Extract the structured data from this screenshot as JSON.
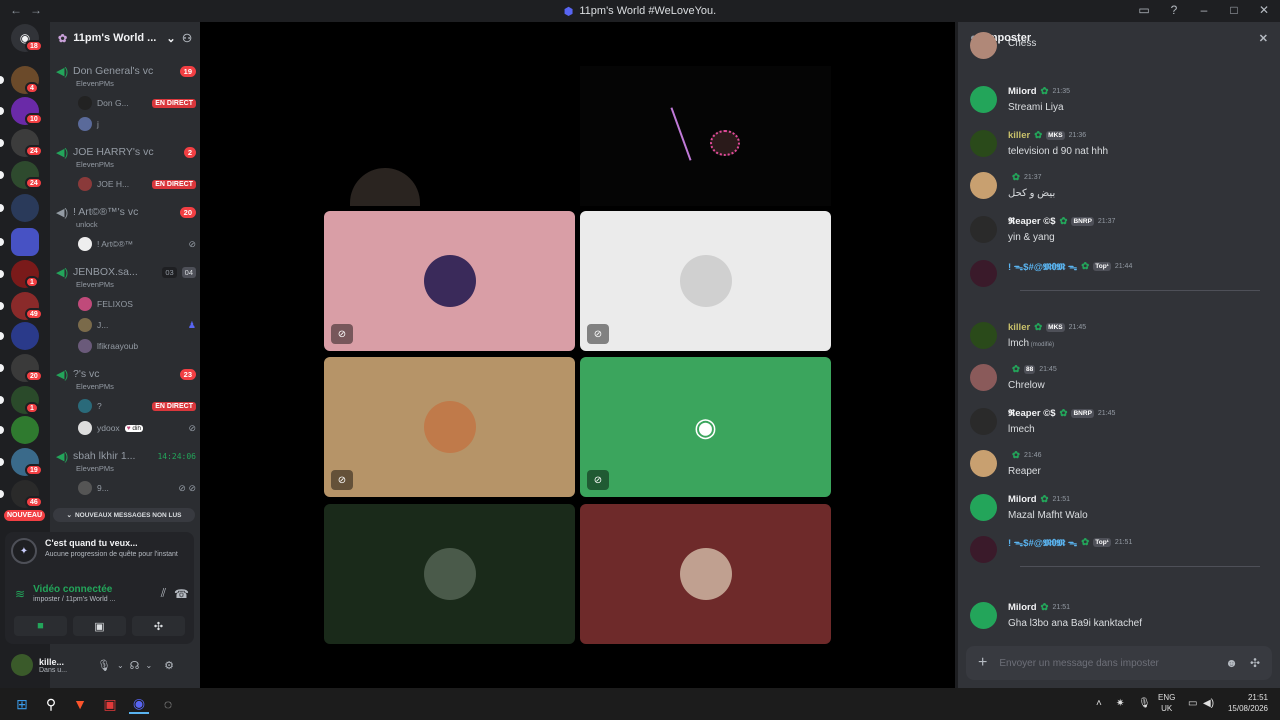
{
  "window": {
    "title": "11pm's World #WeLoveYou."
  },
  "rail": {
    "home_badge": "18",
    "servers": [
      {
        "badge": "4",
        "color": "#6b4a2a"
      },
      {
        "badge": "10",
        "color": "#6a2aa8"
      },
      {
        "badge": "24",
        "color": "#3c3c3c"
      },
      {
        "badge": "24",
        "color": "#2e4a2e"
      },
      {
        "badge": "",
        "color": "#2a3a5a"
      },
      {
        "badge": "",
        "color": "#4752c4"
      },
      {
        "badge": "1",
        "color": "#7a1a1a"
      },
      {
        "badge": "49",
        "color": "#8a2a2a"
      },
      {
        "badge": "",
        "color": "#2a3a8a"
      },
      {
        "badge": "20",
        "color": "#3a3a3a"
      },
      {
        "badge": "1",
        "color": "#2a4a2a"
      },
      {
        "badge": "",
        "color": "#2f7a2f"
      },
      {
        "badge": "19",
        "color": "#3a6a8a"
      },
      {
        "badge": "46",
        "color": "#2a2a2a"
      }
    ],
    "new_label": "NOUVEAU"
  },
  "guild": {
    "name": "11pm's World ..."
  },
  "channels": [
    {
      "name": "Don General's vc",
      "sub": "ElevenPMs",
      "count": "19"
    },
    {
      "name": "JOE HARRY's vc",
      "sub": "ElevenPMs",
      "count": "2"
    },
    {
      "name": "! Art©®™'s vc",
      "sub": "unlock",
      "count": "20"
    },
    {
      "name": "JENBOX.sa...",
      "sub": "ElevenPMs",
      "count_a": "03",
      "count_b": "04"
    },
    {
      "name": "?'s vc",
      "sub": "ElevenPMs",
      "count": "23"
    },
    {
      "name": "sbah lkhir 1...",
      "sub": "ElevenPMs",
      "timer": "14:24:06"
    }
  ],
  "members": {
    "u1": "Don G...",
    "u2": "j",
    "u3": "JOE H...",
    "u4": "! Art©®™",
    "u5": "FELIXOS",
    "u6": "J...",
    "u7": "lfikraayoub",
    "u8": "?",
    "u9": "ydoox",
    "u9_tag": "dih",
    "u10": "9...",
    "live": "EN DIRECT"
  },
  "new_messages": "NOUVEAUX MESSAGES NON LUS",
  "quest": {
    "title": "C'est quand tu veux...",
    "subtitle": "Aucune progression de quête pour l'instant"
  },
  "voice": {
    "status": "Vidéo connectée",
    "location": "imposter / 11pm's World ..."
  },
  "user": {
    "name": "kille...",
    "status": "Dans u..."
  },
  "chat": {
    "channel": "imposter",
    "input_placeholder": "Envoyer un message dans imposter",
    "messages": [
      {
        "author": "",
        "time": "",
        "text": "Chess",
        "avatar_color": "#b08878"
      },
      {
        "author": "Milord",
        "time": "21:35",
        "text": "Streami Liya",
        "avatar_color": "#23a55a"
      },
      {
        "author": "killer",
        "tag": "MKS",
        "time": "21:36",
        "text": "television d 90 nat hhh",
        "avatar_color": "#2a4a1a"
      },
      {
        "author": "",
        "time": "21:37",
        "text": "بيض و كحل",
        "avatar_color": "#c8a070"
      },
      {
        "author": "𝕽eaper ©$",
        "tag": "BNRP",
        "time": "21:37",
        "text": "yin & yang",
        "avatar_color": "#2a2a2a"
      },
      {
        "author": "! ᯓ$#@𝕸𝟎𝕸 ᯓ",
        "tag": "Top¹",
        "time": "21:44",
        "text": "",
        "avatar_color": "#3a1a2a"
      },
      {
        "author": "killer",
        "tag": "MKS",
        "time": "21:45",
        "text": "lmch",
        "edited": "(modifié)",
        "avatar_color": "#2a4a1a"
      },
      {
        "author": "",
        "tag": "88",
        "time": "21:45",
        "text": "Chrelow",
        "avatar_color": "#8a5a5a"
      },
      {
        "author": "𝕽eaper ©$",
        "tag": "BNRP",
        "time": "21:45",
        "text": "lmech",
        "avatar_color": "#2a2a2a"
      },
      {
        "author": "",
        "time": "21:46",
        "text": "Reaper",
        "avatar_color": "#c8a070"
      },
      {
        "author": "Milord",
        "time": "21:51",
        "text": "Mazal Mafht Walo",
        "avatar_color": "#23a55a"
      },
      {
        "author": "! ᯓ$#@𝕸𝟎𝕸 ᯓ",
        "tag": "Top¹",
        "time": "21:51",
        "text": "",
        "avatar_color": "#3a1a2a"
      },
      {
        "author": "Milord",
        "time": "21:51",
        "text": "Gha l3bo ana Ba9i kanktachef",
        "avatar_color": "#23a55a"
      }
    ]
  },
  "tiles": [
    {
      "bg": "#d99ea6",
      "avatar": "#3a2a5a",
      "muted": true
    },
    {
      "bg": "#ebebeb",
      "avatar": "#d0d0d0",
      "muted": true
    },
    {
      "bg": "#b69468",
      "avatar": "#c07a4a",
      "muted": true
    },
    {
      "bg": "#3ba55d",
      "avatar": "",
      "muted": true
    },
    {
      "bg": "#1a2a1a",
      "avatar": "#4a5a4a",
      "muted": false
    },
    {
      "bg": "#6e2a2a",
      "avatar": "#c0a090",
      "muted": false
    }
  ],
  "taskbar": {
    "lang": "ENG",
    "region": "UK",
    "time": "21:51",
    "date": "15/08/2026"
  }
}
